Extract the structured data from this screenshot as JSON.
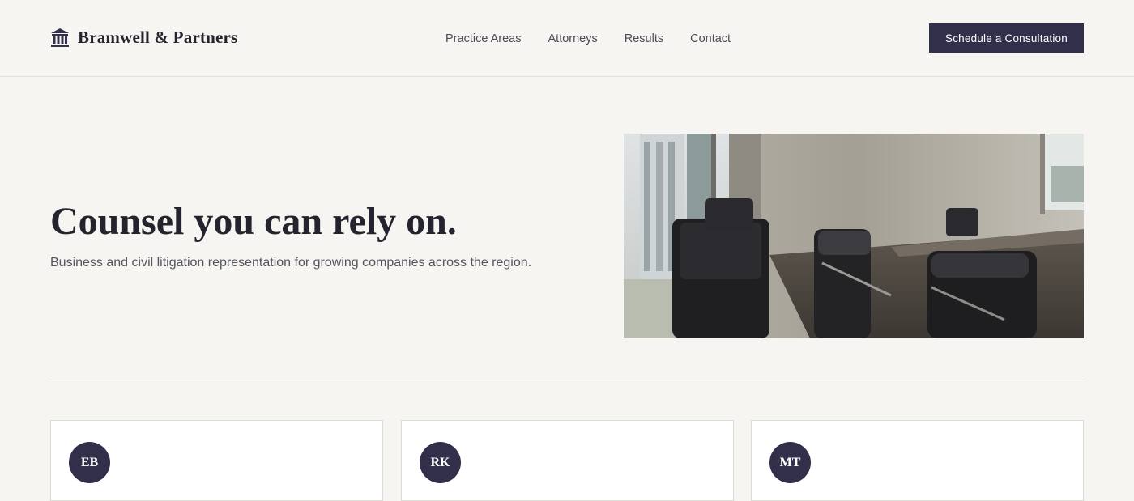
{
  "brand": {
    "name": "Bramwell & Partners",
    "icon": "courthouse-icon"
  },
  "nav": {
    "items": [
      {
        "label": "Practice Areas"
      },
      {
        "label": "Attorneys"
      },
      {
        "label": "Results"
      },
      {
        "label": "Contact"
      }
    ]
  },
  "cta": {
    "label": "Schedule a Consultation"
  },
  "hero": {
    "title": "Counsel you can rely on.",
    "subtitle": "Business and civil litigation representation for growing companies across the region.",
    "image": "conference-room-photo"
  },
  "attorneys": [
    {
      "initials": "EB"
    },
    {
      "initials": "RK"
    },
    {
      "initials": "MT"
    }
  ],
  "colors": {
    "background": "#f6f5f1",
    "accent": "#322f4a",
    "text": "#24232e",
    "muted": "#55545f"
  }
}
